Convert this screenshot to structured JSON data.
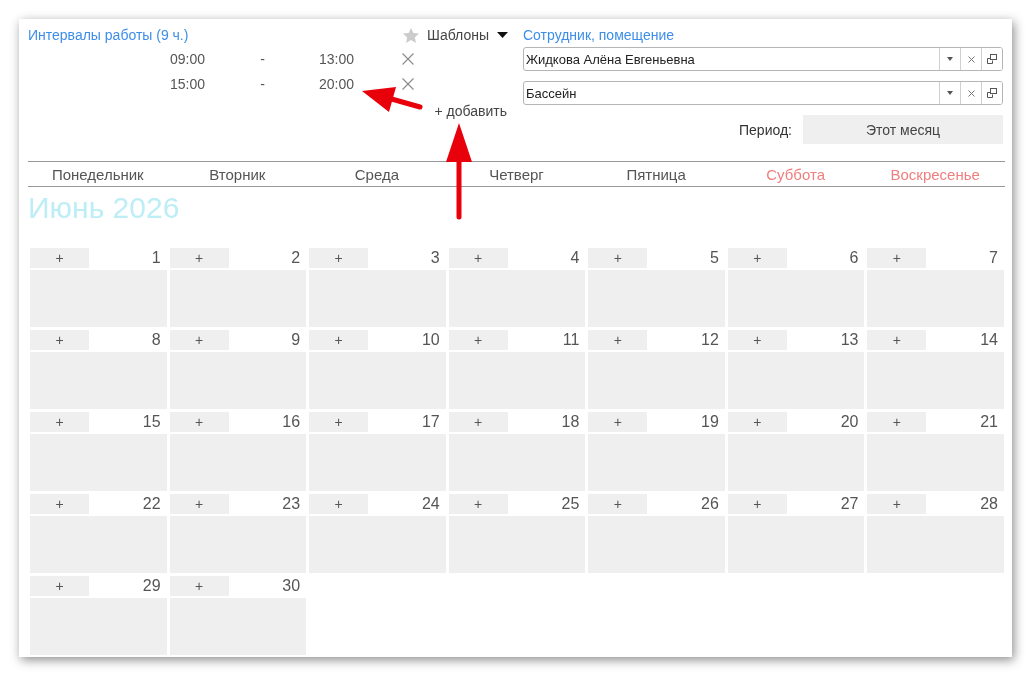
{
  "work_intervals": {
    "title": "Интервалы работы (9 ч.)",
    "templates_button": "Шаблоны",
    "intervals": [
      {
        "start": "09:00",
        "separator": "-",
        "end": "13:00"
      },
      {
        "start": "15:00",
        "separator": "-",
        "end": "20:00"
      }
    ],
    "add_link": "+ добавить"
  },
  "assignment": {
    "title": "Сотрудник, помещение",
    "fields": [
      {
        "value": "Жидкова Алёна Евгеньевна"
      },
      {
        "value": "Бассейн"
      }
    ],
    "period_label": "Период:",
    "period_button": "Этот месяц"
  },
  "calendar": {
    "weekdays": [
      {
        "label": "Понедельник",
        "color": "#555555"
      },
      {
        "label": "Вторник",
        "color": "#555555"
      },
      {
        "label": "Среда",
        "color": "#555555"
      },
      {
        "label": "Четверг",
        "color": "#555555"
      },
      {
        "label": "Пятница",
        "color": "#555555"
      },
      {
        "label": "Суббота",
        "color": "#ee7f7f"
      },
      {
        "label": "Воскресенье",
        "color": "#ee7f7f"
      }
    ],
    "month_title": "Июнь 2026",
    "days": [
      {
        "number": "1",
        "add_button": "+"
      },
      {
        "number": "2",
        "add_button": "+"
      },
      {
        "number": "3",
        "add_button": "+"
      },
      {
        "number": "4",
        "add_button": "+"
      },
      {
        "number": "5",
        "add_button": "+"
      },
      {
        "number": "6",
        "add_button": "+"
      },
      {
        "number": "7",
        "add_button": "+"
      },
      {
        "number": "8",
        "add_button": "+"
      },
      {
        "number": "9",
        "add_button": "+"
      },
      {
        "number": "10",
        "add_button": "+"
      },
      {
        "number": "11",
        "add_button": "+"
      },
      {
        "number": "12",
        "add_button": "+"
      },
      {
        "number": "13",
        "add_button": "+"
      },
      {
        "number": "14",
        "add_button": "+"
      },
      {
        "number": "15",
        "add_button": "+"
      },
      {
        "number": "16",
        "add_button": "+"
      },
      {
        "number": "17",
        "add_button": "+"
      },
      {
        "number": "18",
        "add_button": "+"
      },
      {
        "number": "19",
        "add_button": "+"
      },
      {
        "number": "20",
        "add_button": "+"
      },
      {
        "number": "21",
        "add_button": "+"
      },
      {
        "number": "22",
        "add_button": "+"
      },
      {
        "number": "23",
        "add_button": "+"
      },
      {
        "number": "24",
        "add_button": "+"
      },
      {
        "number": "25",
        "add_button": "+"
      },
      {
        "number": "26",
        "add_button": "+"
      },
      {
        "number": "27",
        "add_button": "+"
      },
      {
        "number": "28",
        "add_button": "+"
      },
      {
        "number": "29",
        "add_button": "+"
      },
      {
        "number": "30",
        "add_button": "+"
      }
    ]
  }
}
